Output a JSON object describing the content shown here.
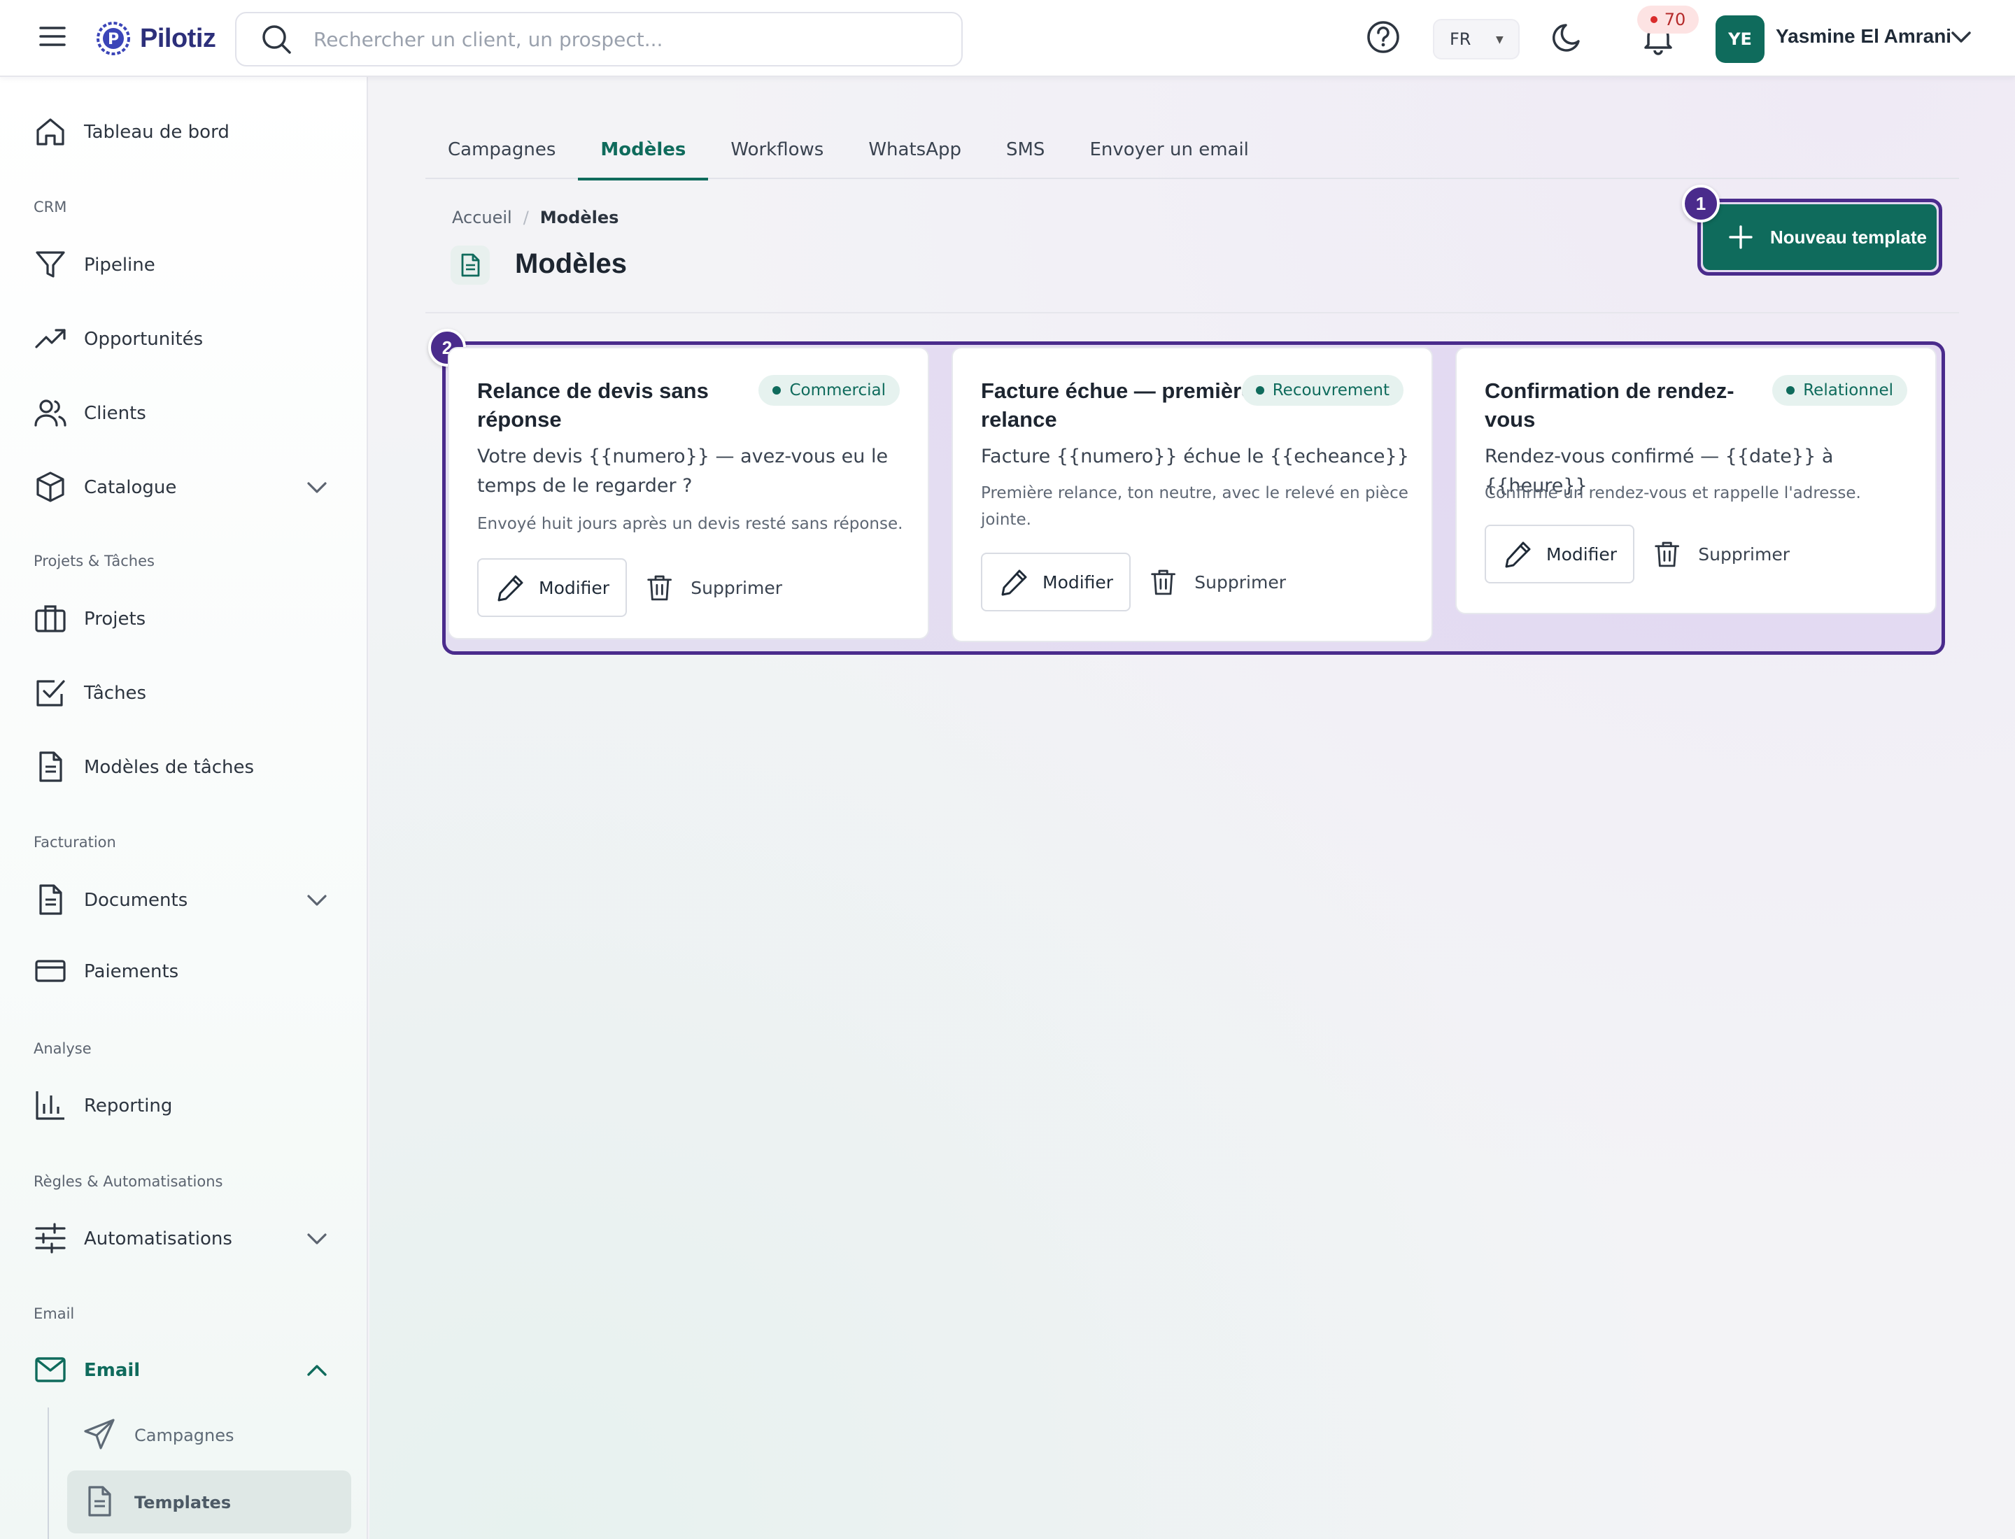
{
  "app": {
    "brand": "Pilotiz",
    "colors": {
      "accent": "#0f6b5c",
      "highlight": "#4a2b8c",
      "notification": "#d92c2c"
    }
  },
  "topbar": {
    "search_placeholder": "Rechercher un client, un prospect...",
    "language": "FR",
    "notifications_count": "70",
    "user_initials": "YE",
    "user_name": "Yasmine El Amrani",
    "icons": [
      "menu-icon",
      "search-icon",
      "help-icon",
      "moon-icon",
      "bell-icon",
      "chevron-down-icon"
    ]
  },
  "sidebar": {
    "dashboard": "Tableau de bord",
    "sections": {
      "crm": "CRM",
      "projects": "Projets & Tâches",
      "billing": "Facturation",
      "analysis": "Analyse",
      "rules": "Règles & Automatisations",
      "email": "Email"
    },
    "items": {
      "pipeline": "Pipeline",
      "opportunities": "Opportunités",
      "clients": "Clients",
      "catalogue": "Catalogue",
      "projects": "Projets",
      "tasks": "Tâches",
      "task_templates": "Modèles de tâches",
      "documents": "Documents",
      "payments": "Paiements",
      "reporting": "Reporting",
      "automations": "Automatisations",
      "email": "Email"
    },
    "email_sub": {
      "campaigns": "Campagnes",
      "templates": "Templates"
    }
  },
  "tabs": [
    "Campagnes",
    "Modèles",
    "Workflows",
    "WhatsApp",
    "SMS",
    "Envoyer un email"
  ],
  "active_tab": "Modèles",
  "breadcrumb": {
    "home": "Accueil",
    "separator": "/",
    "current": "Modèles"
  },
  "page": {
    "title": "Modèles",
    "new_button": "Nouveau template",
    "step_badges": [
      "1",
      "2"
    ]
  },
  "cards": [
    {
      "title": "Relance de devis sans réponse",
      "tag": "Commercial",
      "subject": "Votre devis {{numero}} — avez-vous eu le temps de le regarder ?",
      "description": "Envoyé huit jours après un devis resté sans réponse.",
      "edit": "Modifier",
      "delete": "Supprimer"
    },
    {
      "title": "Facture échue — première relance",
      "tag": "Recouvrement",
      "subject": "Facture {{numero}} échue le {{echeance}}",
      "description": "Première relance, ton neutre, avec le relevé en pièce jointe.",
      "edit": "Modifier",
      "delete": "Supprimer"
    },
    {
      "title": "Confirmation de rendez-vous",
      "tag": "Relationnel",
      "subject": "Rendez-vous confirmé — {{date}} à {{heure}}",
      "description": "Confirme un rendez-vous et rappelle l'adresse.",
      "edit": "Modifier",
      "delete": "Supprimer"
    }
  ]
}
